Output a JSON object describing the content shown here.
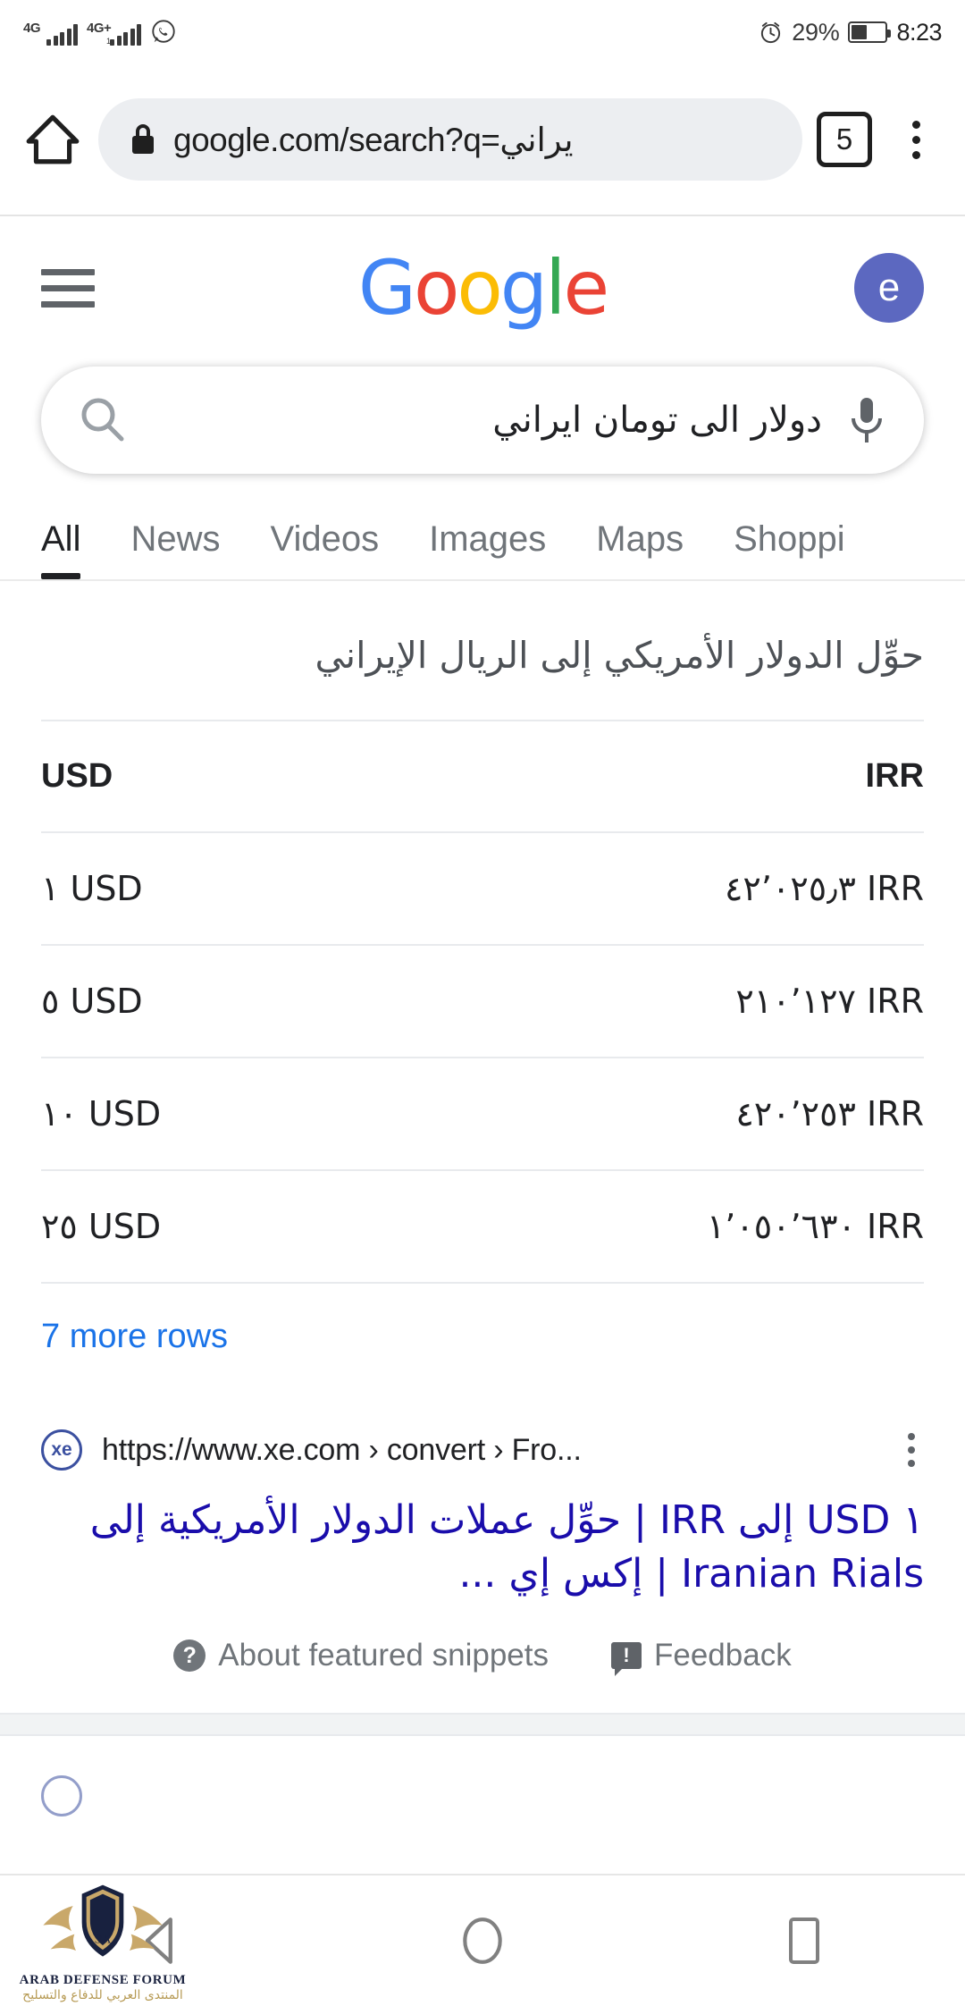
{
  "status_bar": {
    "network_1": "4G",
    "network_2": "4G+",
    "network_2_sub": "1",
    "whatsapp_icon": "whatsapp-icon",
    "alarm_icon": "alarm-icon",
    "battery_percent": "29%",
    "battery_icon": "battery-icon",
    "time": "8:23"
  },
  "browser": {
    "home_icon": "home-icon",
    "lock_icon": "lock-icon",
    "url": "google.com/search?q=يراني",
    "tab_count": "5",
    "menu_icon": "kebab-menu-icon"
  },
  "google_header": {
    "menu_icon": "hamburger-menu-icon",
    "logo": {
      "g1": "G",
      "o1": "o",
      "o2": "o",
      "g2": "g",
      "l": "l",
      "e": "e"
    },
    "avatar_initial": "e"
  },
  "search": {
    "search_icon": "search-icon",
    "query": "دولار الى تومان ايراني",
    "mic_icon": "microphone-icon"
  },
  "tabs": [
    {
      "label": "All",
      "active": true
    },
    {
      "label": "News",
      "active": false
    },
    {
      "label": "Videos",
      "active": false
    },
    {
      "label": "Images",
      "active": false
    },
    {
      "label": "Maps",
      "active": false
    },
    {
      "label": "Shoppi",
      "active": false
    }
  ],
  "featured_snippet": {
    "title": "حوِّل الدولار الأمريكي إلى الريال الإيراني",
    "columns": {
      "left": "USD",
      "right": "IRR"
    },
    "rows": [
      {
        "usd": "١ USD",
        "irr": "٤٢٬٠٢٥٫٣ IRR"
      },
      {
        "usd": "٥ USD",
        "irr": "٢١٠٬١٢٧ IRR"
      },
      {
        "usd": "١٠ USD",
        "irr": "٤٢٠٬٢٥٣ IRR"
      },
      {
        "usd": "٢٥ USD",
        "irr": "١٬٠٥٠٬٦٣٠ IRR"
      }
    ],
    "more_rows": "7 more rows",
    "source": {
      "favicon_label": "xe",
      "url": "https://www.xe.com › convert › Fro...",
      "menu_icon": "kebab-menu-icon",
      "title": "١ USD إلى IRR | حوِّل عملات الدولار الأمريكية إلى Iranian Rials | إكس إي ..."
    },
    "footer": {
      "about_icon": "question-mark-icon",
      "about_label": "About featured snippets",
      "feedback_icon": "feedback-icon",
      "feedback_label": "Feedback"
    }
  },
  "nav_bar": {
    "back_icon": "back-triangle-icon",
    "home_icon": "home-circle-icon",
    "recents_icon": "recents-square-icon"
  },
  "watermark": {
    "name": "ARAB DEFENSE FORUM",
    "arabic": "المنتدى العربي للدفاع والتسليح"
  },
  "colors": {
    "google_blue": "#4285F4",
    "google_red": "#EA4335",
    "google_yellow": "#FBBC05",
    "google_green": "#34A853",
    "link_blue": "#1a0dab",
    "more_rows_blue": "#1a73e8",
    "avatar_bg": "#5c68c0"
  },
  "chart_data": {
    "type": "table",
    "title": "حوِّل الدولار الأمريكي إلى الريال الإيراني",
    "categories": [
      "١ USD",
      "٥ USD",
      "١٠ USD",
      "٢٥ USD"
    ],
    "series": [
      {
        "name": "IRR",
        "values": [
          "٤٢٬٠٢٥٫٣ IRR",
          "٢١٠٬١٢٧ IRR",
          "٤٢٠٬٢٥٣ IRR",
          "١٬٠٥٠٬٦٣٠ IRR"
        ]
      }
    ],
    "xlabel": "USD",
    "ylabel": "IRR"
  }
}
